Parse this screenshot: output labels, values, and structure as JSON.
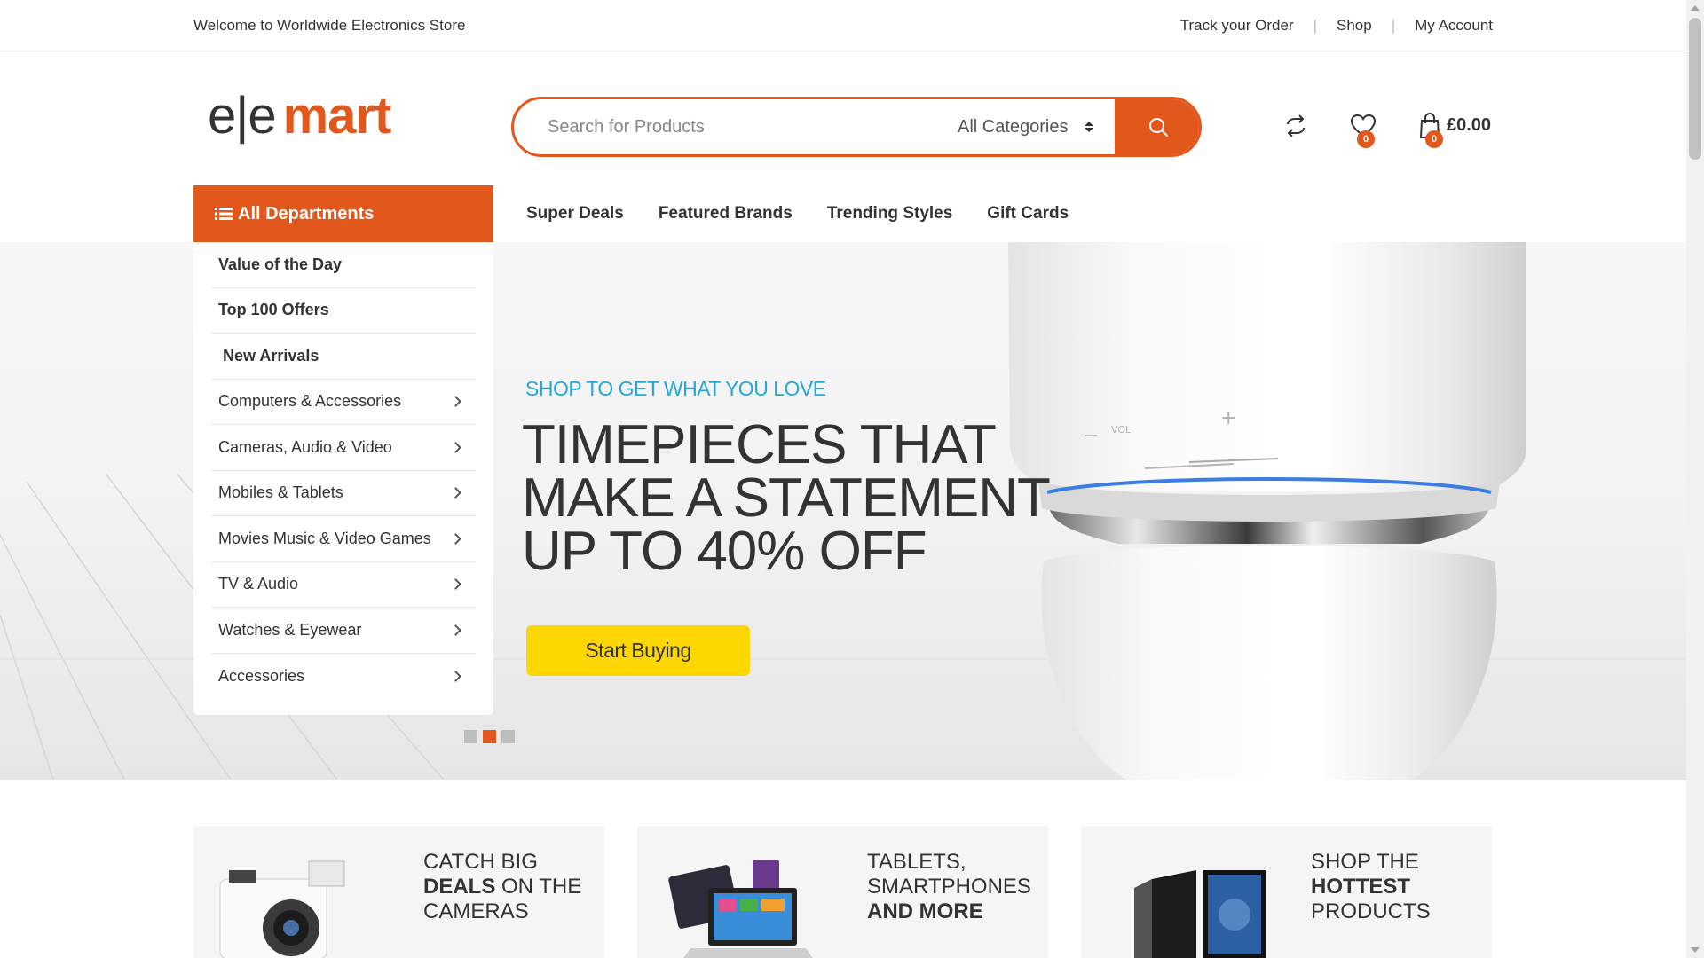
{
  "topbar": {
    "welcome": "Welcome to Worldwide Electronics Store",
    "links": [
      "Track your Order",
      "Shop",
      "My Account"
    ],
    "separator": "|"
  },
  "logo": {
    "part1": "e|e",
    "part2": "mart"
  },
  "search": {
    "placeholder": "Search for Products",
    "category": "All Categories"
  },
  "header": {
    "wishlist_count": "0",
    "cart_count": "0",
    "cart_total": "£0.00"
  },
  "nav": {
    "departments_label": "All Departments",
    "items": [
      "Super Deals",
      "Featured Brands",
      "Trending Styles",
      "Gift Cards"
    ]
  },
  "departments": [
    {
      "label": "Value of the Day",
      "bold": true,
      "arrow": false
    },
    {
      "label": "Top 100 Offers",
      "bold": true,
      "arrow": false
    },
    {
      "label": "New Arrivals",
      "bold": true,
      "arrow": false
    },
    {
      "label": "Computers & Accessories",
      "bold": false,
      "arrow": true
    },
    {
      "label": "Cameras, Audio & Video",
      "bold": false,
      "arrow": true
    },
    {
      "label": "Mobiles & Tablets",
      "bold": false,
      "arrow": true
    },
    {
      "label": "Movies Music & Video Games",
      "bold": false,
      "arrow": true
    },
    {
      "label": "TV & Audio",
      "bold": false,
      "arrow": true
    },
    {
      "label": "Watches & Eyewear",
      "bold": false,
      "arrow": true
    },
    {
      "label": "Accessories",
      "bold": false,
      "arrow": true
    }
  ],
  "hero": {
    "subtitle": "SHOP TO GET WHAT YOU LOVE",
    "title_lines": [
      "TIMEPIECES THAT",
      "MAKE A STATEMENT",
      "UP TO 40% OFF"
    ],
    "button": "Start Buying",
    "product_labels": {
      "vol": "VOL",
      "minus": "−",
      "plus": "+"
    },
    "slide_count": 3,
    "active_slide": 2
  },
  "promos": [
    {
      "l1": "CATCH BIG",
      "l2b": "DEALS",
      "l2": " ON THE",
      "l3": "CAMERAS"
    },
    {
      "l1": "TABLETS,",
      "l2b": "",
      "l2": "SMARTPHONES",
      "l3b": "AND MORE"
    },
    {
      "l1": "SHOP THE",
      "l2b": "HOTTEST",
      "l2": "",
      "l3": "PRODUCTS"
    }
  ],
  "colors": {
    "accent": "#e2571b",
    "subtitle": "#25a7da",
    "button": "#fed700"
  },
  "icons": [
    "search-icon",
    "compare-icon",
    "heart-icon",
    "shopping-bag-icon",
    "menu-list-icon",
    "chevron-right-icon"
  ]
}
